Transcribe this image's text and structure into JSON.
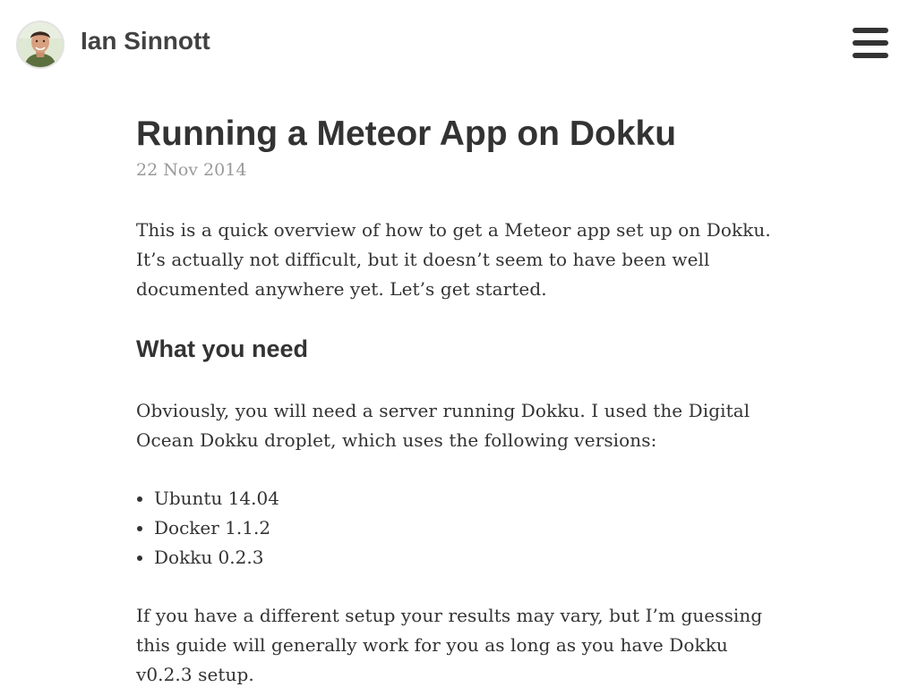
{
  "header": {
    "site_title": "Ian Sinnott",
    "avatar_icon": "avatar-photo",
    "menu_icon": "hamburger-menu-icon"
  },
  "post": {
    "title": "Running a Meteor App on Dokku",
    "date": "22 Nov 2014",
    "paragraphs": {
      "intro": "This is a quick overview of how to get a Meteor app set up on Dokku. It’s actually not difficult, but it doesn’t seem to have been well documented anywhere yet. Let’s get started.",
      "versions": "Obviously, you will need a server running Dokku. I used the Digital Ocean Dokku droplet, which uses the following versions:",
      "results": "If you have a different setup your results may vary, but I’m guessing this guide will generally work for you as long as you have Dokku v0.2.3 setup."
    },
    "section_heading": "What you need",
    "versions_list": [
      "Ubuntu 14.04",
      "Docker 1.1.2",
      "Dokku 0.2.3"
    ]
  },
  "colors": {
    "text": "#333333",
    "date": "#9a9a9a",
    "background": "#ffffff"
  }
}
